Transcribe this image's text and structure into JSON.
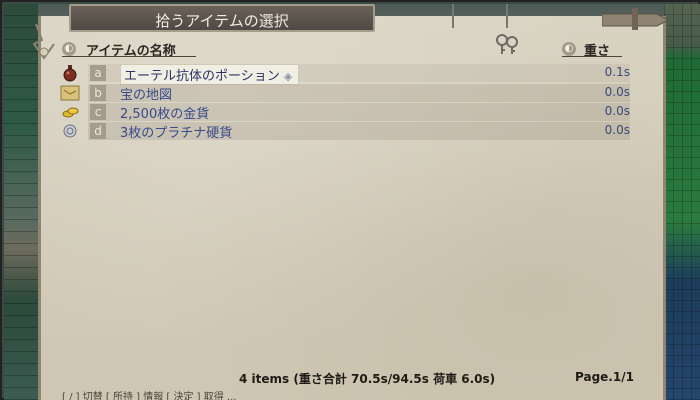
{
  "window": {
    "title": "拾うアイテムの選択"
  },
  "columns": {
    "name_header": "アイテムの名称",
    "weight_header": "重さ"
  },
  "items": [
    {
      "letter": "a",
      "name": "エーテル抗体のポーション",
      "weight": "0.1s",
      "icon": "potion-icon",
      "selected": true
    },
    {
      "letter": "b",
      "name": "宝の地図",
      "weight": "0.0s",
      "icon": "treasure-map-icon",
      "selected": false
    },
    {
      "letter": "c",
      "name": "2,500枚の金貨",
      "weight": "0.0s",
      "icon": "gold-coins-icon",
      "selected": false
    },
    {
      "letter": "d",
      "name": "3枚のプラチナ硬貨",
      "weight": "0.0s",
      "icon": "platinum-coin-icon",
      "selected": false
    }
  ],
  "footer": {
    "summary": "4 items (重さ合計 70.5s/94.5s 荷車 6.0s)",
    "page": "Page.1/1",
    "hint_bar": "[ / ] 切替  [ 所持 ] 情報  [ 決定 ] 取得  ..."
  },
  "colors": {
    "parchment": "#d6cfbd",
    "text_dark": "#2a2622",
    "item_blue": "#3a4a8a",
    "title_plate": "#5a534c"
  }
}
